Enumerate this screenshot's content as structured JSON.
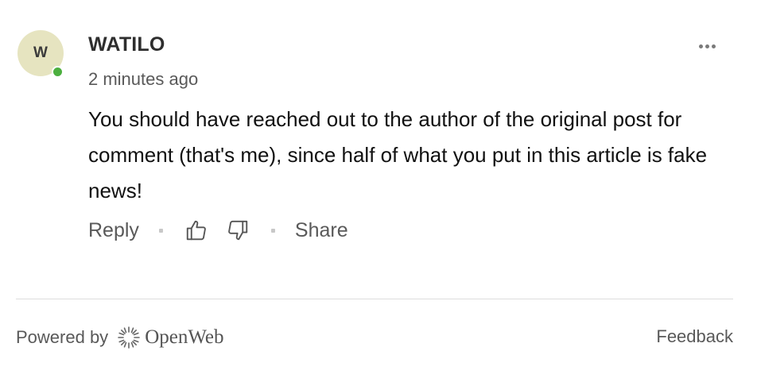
{
  "comment": {
    "avatar_initial": "W",
    "username": "WATILO",
    "timestamp": "2 minutes ago",
    "body": "You should have reached out to the author of the original post for comment (that's me), since half of what you put in this article is fake news!",
    "online_status_color": "#4caf3f",
    "avatar_color": "#e6e4c0"
  },
  "actions": {
    "reply_label": "Reply",
    "share_label": "Share",
    "upvote_icon": "thumbs-up-icon",
    "downvote_icon": "thumbs-down-icon"
  },
  "menu": {
    "more_icon": "more-options-icon"
  },
  "footer": {
    "powered_by": "Powered by",
    "brand": "OpenWeb",
    "feedback_label": "Feedback"
  }
}
